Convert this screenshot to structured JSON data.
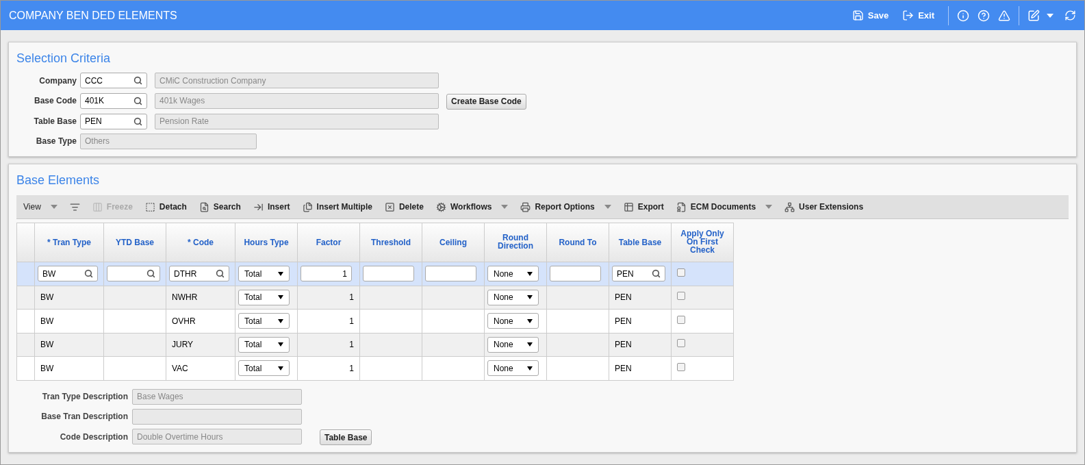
{
  "window": {
    "title": "COMPANY BEN DED ELEMENTS"
  },
  "header_actions": [
    {
      "kind": "save",
      "label": "Save"
    },
    {
      "kind": "exit",
      "label": "Exit"
    }
  ],
  "selection": {
    "title": "Selection Criteria",
    "fields": [
      {
        "label": "Company",
        "value": "CCC",
        "description": "CMiC Construction Company",
        "kind": "lookup"
      },
      {
        "label": "Base Code",
        "value": "401K",
        "description": "401k Wages",
        "kind": "lookup",
        "button": "Create Base Code"
      },
      {
        "label": "Table Base",
        "value": "PEN",
        "description": "Pension Rate",
        "kind": "lookup"
      },
      {
        "label": "Base Type",
        "value": "Others",
        "kind": "readonly"
      }
    ]
  },
  "base_elements": {
    "title": "Base Elements",
    "toolbar": [
      {
        "kind": "view",
        "label": "View",
        "dropdown": true,
        "disabled": false
      },
      {
        "kind": "filter",
        "disabled": false
      },
      {
        "kind": "freeze",
        "label": "Freeze",
        "disabled": true
      },
      {
        "kind": "detach",
        "label": "Detach",
        "disabled": false
      },
      {
        "kind": "search",
        "label": "Search",
        "disabled": false
      },
      {
        "kind": "insert",
        "label": "Insert",
        "disabled": false
      },
      {
        "kind": "insert_multiple",
        "label": "Insert Multiple",
        "disabled": false
      },
      {
        "kind": "delete",
        "label": "Delete",
        "disabled": false
      },
      {
        "kind": "workflows",
        "label": "Workflows",
        "dropdown": true,
        "disabled": false
      },
      {
        "kind": "report",
        "label": "Report Options",
        "dropdown": true,
        "disabled": false
      },
      {
        "kind": "export",
        "label": "Export",
        "disabled": false
      },
      {
        "kind": "ecm",
        "label": "ECM Documents",
        "dropdown": true,
        "disabled": false
      },
      {
        "kind": "extensions",
        "label": "User Extensions",
        "disabled": false
      }
    ],
    "table": {
      "columns": [
        "* Tran Type",
        "YTD Base",
        "* Code",
        "Hours Type",
        "Factor",
        "Threshold",
        "Ceiling",
        "Round Direction",
        "Round To",
        "Table Base",
        "Apply Only On First Check"
      ],
      "rows": [
        {
          "selected": true,
          "tran_type": "BW",
          "ytd_base": "",
          "code": "DTHR",
          "hours_type": "Total",
          "factor": "1",
          "threshold": "",
          "ceiling": "",
          "round_direction": "None",
          "round_to": "",
          "table_base": "PEN",
          "apply_first": false
        },
        {
          "selected": false,
          "tran_type": "BW",
          "ytd_base": "",
          "code": "NWHR",
          "hours_type": "Total",
          "factor": "1",
          "threshold": "",
          "ceiling": "",
          "round_direction": "None",
          "round_to": "",
          "table_base": "PEN",
          "apply_first": false
        },
        {
          "selected": false,
          "tran_type": "BW",
          "ytd_base": "",
          "code": "OVHR",
          "hours_type": "Total",
          "factor": "1",
          "threshold": "",
          "ceiling": "",
          "round_direction": "None",
          "round_to": "",
          "table_base": "PEN",
          "apply_first": false
        },
        {
          "selected": false,
          "tran_type": "BW",
          "ytd_base": "",
          "code": "JURY",
          "hours_type": "Total",
          "factor": "1",
          "threshold": "",
          "ceiling": "",
          "round_direction": "None",
          "round_to": "",
          "table_base": "PEN",
          "apply_first": false
        },
        {
          "selected": false,
          "tran_type": "BW",
          "ytd_base": "",
          "code": "VAC",
          "hours_type": "Total",
          "factor": "1",
          "threshold": "",
          "ceiling": "",
          "round_direction": "None",
          "round_to": "",
          "table_base": "PEN",
          "apply_first": false
        }
      ]
    },
    "descriptions": [
      {
        "label": "Tran Type Description",
        "value": "Base Wages"
      },
      {
        "label": "Base Tran Description"
      },
      {
        "label": "Code Description",
        "value": "Double Overtime Hours",
        "button": "Table Base"
      }
    ]
  }
}
